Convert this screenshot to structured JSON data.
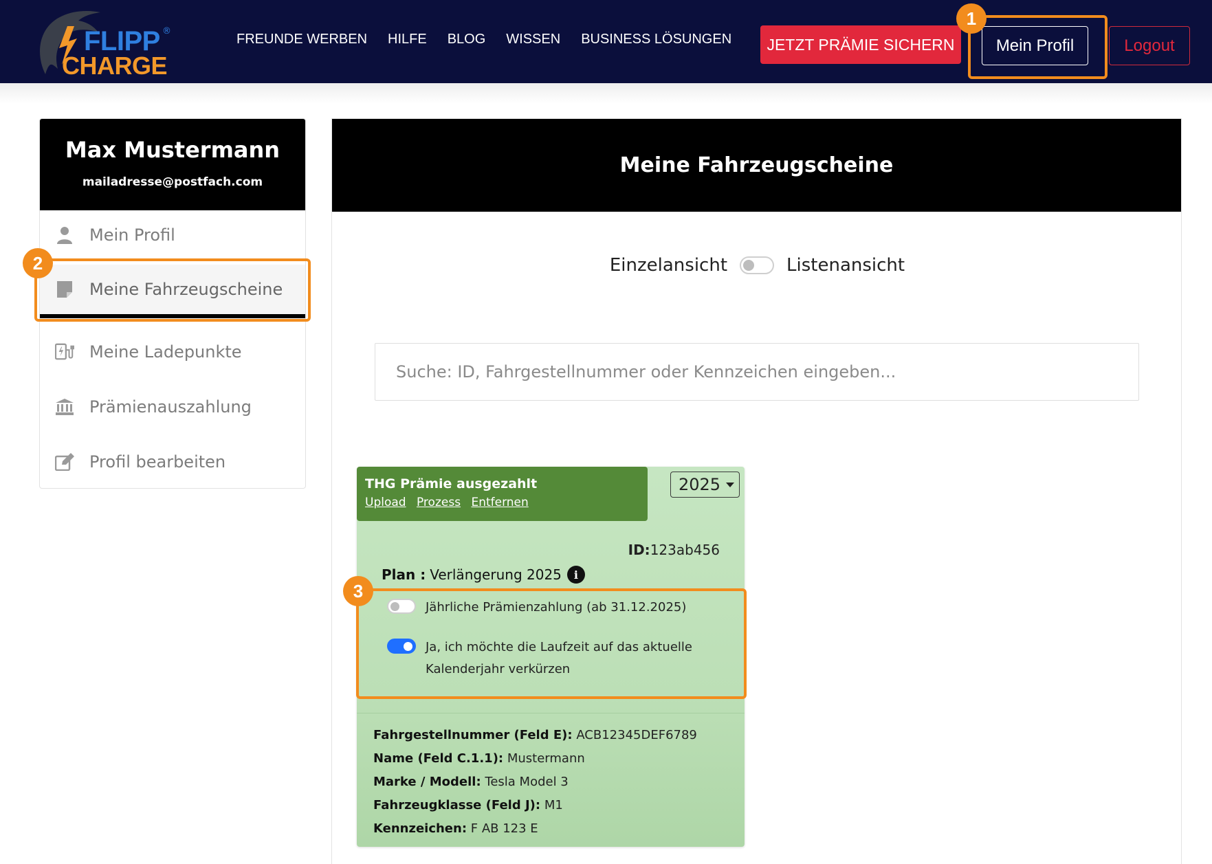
{
  "brand": {
    "line1": "FLIPP",
    "line2": "CHARGE",
    "reg": "®",
    "colors": {
      "blue": "#2f7fe0",
      "orange": "#f2982a",
      "header_bg": "#0b0f3c"
    }
  },
  "nav": {
    "items": [
      "FREUNDE WERBEN",
      "HILFE",
      "BLOG",
      "WISSEN",
      "BUSINESS LÖSUNGEN"
    ]
  },
  "header": {
    "cta_label": "JETZT PRÄMIE SICHERN",
    "profile_label": "Mein Profil",
    "logout_label": "Logout"
  },
  "badges": {
    "one": "1",
    "two": "2",
    "three": "3"
  },
  "sidebar": {
    "name": "Max Mustermann",
    "email": "mailadresse@postfach.com",
    "items": [
      {
        "label": "Mein Profil",
        "icon": "user-icon"
      },
      {
        "label": "Meine Fahrzeugscheine",
        "icon": "document-icon"
      },
      {
        "label": "Meine Ladepunkte",
        "icon": "charging-station-icon"
      },
      {
        "label": "Prämienauszahlung",
        "icon": "bank-icon"
      },
      {
        "label": "Profil bearbeiten",
        "icon": "edit-icon"
      }
    ]
  },
  "main": {
    "title": "Meine Fahrzeugscheine",
    "view_left": "Einzelansicht",
    "view_right": "Listenansicht",
    "search_placeholder": "Suche: ID, Fahrgestellnummer oder Kennzeichen eingeben..."
  },
  "card": {
    "status_title": "THG Prämie ausgezahlt",
    "links": [
      "Upload",
      "Prozess",
      "Entfernen"
    ],
    "year": "2025",
    "id_label": "ID:",
    "id_value": "123ab456",
    "plan_label": "Plan :",
    "plan_value": "Verlängerung 2025",
    "info_glyph": "i",
    "option1": "Jährliche Prämienzahlung (ab 31.12.2025)",
    "option2_line1": "Ja, ich möchte die Laufzeit auf das aktuelle",
    "option2_line2": "Kalenderjahr verkürzen",
    "details": [
      {
        "label": "Fahrgestellnummer (Feld E):",
        "value": "ACB12345DEF6789"
      },
      {
        "label": "Name (Feld C.1.1):",
        "value": "Mustermann"
      },
      {
        "label": "Marke / Modell:",
        "value": "Tesla Model 3"
      },
      {
        "label": "Fahrzeugklasse (Feld J):",
        "value": "M1"
      },
      {
        "label": "Kennzeichen:",
        "value": "F AB 123 E"
      }
    ]
  }
}
